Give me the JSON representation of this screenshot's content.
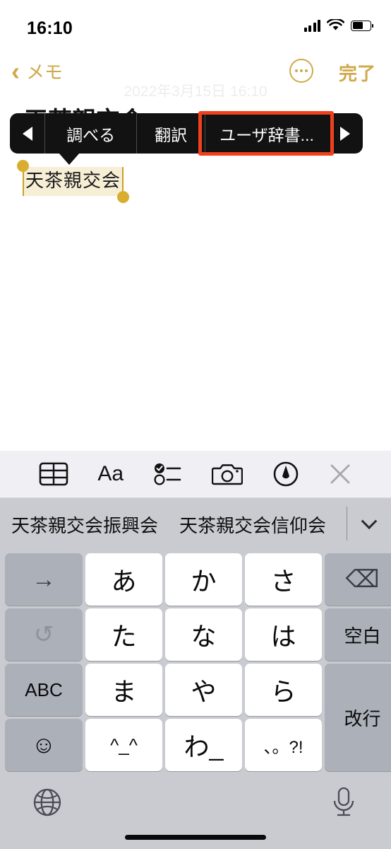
{
  "status_bar": {
    "time": "16:10",
    "signal_icon": "cellular-signal-icon",
    "wifi_icon": "wifi-icon",
    "battery_icon": "battery-icon",
    "battery_level_percent": 62
  },
  "nav_bar": {
    "back_label": "メモ",
    "back_icon": "chevron-left-icon",
    "more_icon": "ellipsis-circle-icon",
    "done_label": "完了"
  },
  "note": {
    "date": "2022年3月15日 16:10",
    "title": "天茶親交会",
    "selected_text": "天茶親交会"
  },
  "context_menu": {
    "prev_icon": "triangle-left-icon",
    "next_icon": "triangle-right-icon",
    "items": [
      {
        "label": "調べる",
        "highlighted": false
      },
      {
        "label": "翻訳",
        "highlighted": false
      },
      {
        "label": "ユーザ辞書...",
        "highlighted": true
      }
    ],
    "highlight_color": "#F0401C"
  },
  "keyboard": {
    "toolbar": [
      {
        "name": "table-icon",
        "label": ""
      },
      {
        "name": "text-format-icon",
        "label": "Aa"
      },
      {
        "name": "checklist-icon",
        "label": ""
      },
      {
        "name": "camera-icon",
        "label": ""
      },
      {
        "name": "markup-pen-icon",
        "label": ""
      },
      {
        "name": "close-icon",
        "label": ""
      }
    ],
    "predictions": [
      "天茶親交会振興会",
      "天茶親交会信仰会"
    ],
    "expand_icon": "chevron-down-icon",
    "keys": [
      {
        "label": "→",
        "name": "next-candidate-key",
        "style": "gray",
        "row": 0,
        "col": 0
      },
      {
        "label": "あ",
        "name": "kana-a-key",
        "style": "white",
        "row": 0,
        "col": 1
      },
      {
        "label": "か",
        "name": "kana-ka-key",
        "style": "white",
        "row": 0,
        "col": 2
      },
      {
        "label": "さ",
        "name": "kana-sa-key",
        "style": "white",
        "row": 0,
        "col": 3
      },
      {
        "label": "⌫",
        "name": "delete-key",
        "style": "gray",
        "row": 0,
        "col": 4
      },
      {
        "label": "↺",
        "name": "undo-key",
        "style": "gray",
        "row": 1,
        "col": 0
      },
      {
        "label": "た",
        "name": "kana-ta-key",
        "style": "white",
        "row": 1,
        "col": 1
      },
      {
        "label": "な",
        "name": "kana-na-key",
        "style": "white",
        "row": 1,
        "col": 2
      },
      {
        "label": "は",
        "name": "kana-ha-key",
        "style": "white",
        "row": 1,
        "col": 3
      },
      {
        "label": "空白",
        "name": "space-key",
        "style": "gray",
        "row": 1,
        "col": 4
      },
      {
        "label": "ABC",
        "name": "abc-key",
        "style": "gray",
        "row": 2,
        "col": 0
      },
      {
        "label": "ま",
        "name": "kana-ma-key",
        "style": "white",
        "row": 2,
        "col": 1
      },
      {
        "label": "や",
        "name": "kana-ya-key",
        "style": "white",
        "row": 2,
        "col": 2
      },
      {
        "label": "ら",
        "name": "kana-ra-key",
        "style": "white",
        "row": 2,
        "col": 3
      },
      {
        "label": "改行",
        "name": "return-key",
        "style": "gray",
        "row": 2,
        "col": 4
      },
      {
        "label": "☺",
        "name": "emoji-key",
        "style": "gray",
        "row": 3,
        "col": 0
      },
      {
        "label": "^_^",
        "name": "kaomoji-key",
        "style": "white",
        "row": 3,
        "col": 1
      },
      {
        "label": "わ_",
        "name": "kana-wa-key",
        "style": "white",
        "row": 3,
        "col": 2
      },
      {
        "label": "、。?!",
        "name": "punctuation-key",
        "style": "white",
        "row": 3,
        "col": 3
      }
    ],
    "bottom": {
      "globe_icon": "globe-icon",
      "mic_icon": "microphone-icon"
    }
  }
}
